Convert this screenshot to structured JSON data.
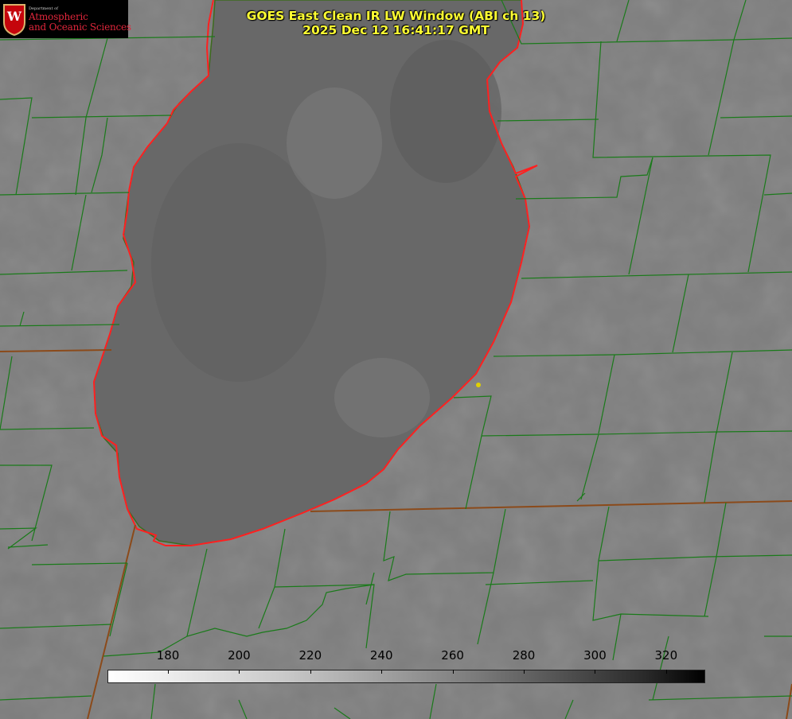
{
  "header": {
    "title_line1": "GOES East Clean IR LW Window (ABI ch 13)",
    "title_line2": "2025 Dec 12 16:41:17 GMT"
  },
  "logo": {
    "dept_line": "Department of",
    "line1": "Atmospheric",
    "line2": "and Oceanic Sciences",
    "seal_letter": "W"
  },
  "colorbar": {
    "ticks": [
      "180",
      "200",
      "220",
      "240",
      "260",
      "280",
      "300",
      "320"
    ],
    "tick_values": [
      180,
      200,
      220,
      240,
      260,
      280,
      300,
      320
    ],
    "range": [
      163,
      331
    ],
    "start_color": "#ffffff",
    "end_color": "#000000"
  },
  "map": {
    "background_color": "#7d7d7d",
    "lake_color": "#6a6a6a",
    "county_line_color": "#1a7a1a",
    "state_line_color": "#8b4a1a",
    "lakeshore_color": "#ff2020",
    "marker_color": "#e0d000"
  }
}
